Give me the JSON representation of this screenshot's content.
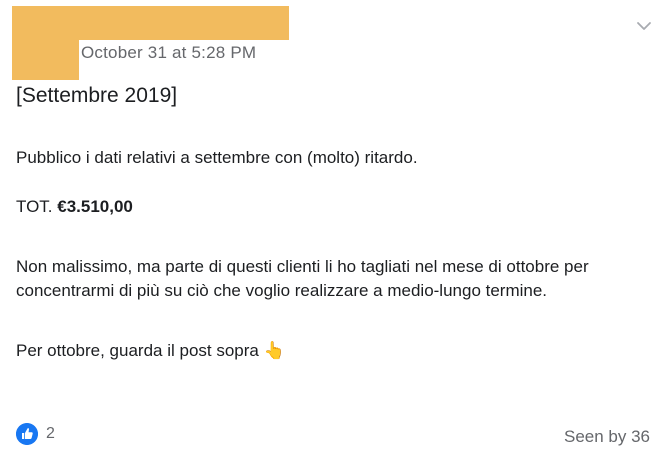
{
  "post": {
    "timestamp": "October 31 at 5:28 PM",
    "title": "[Settembre 2019]",
    "intro": "Pubblico i dati relativi a settembre con (molto) ritardo.",
    "total_label": "TOT. ",
    "total_value": "€3.510,00",
    "body": "Non malissimo, ma parte di questi clienti li ho tagliati nel mese di ottobre per concentrarmi di più su ciò che voglio realizzare a medio-lungo termine.",
    "closing": "Per ottobre, guarda il post sopra ",
    "closing_emoji": "👆"
  },
  "footer": {
    "reaction_count": "2",
    "seen_by": "Seen by 36"
  },
  "icons": {
    "menu": "chevron-down-icon",
    "reaction": "like-icon"
  },
  "colors": {
    "redaction": "#f2bb5e",
    "like_blue": "#1877f2",
    "muted_text": "#65676b"
  }
}
